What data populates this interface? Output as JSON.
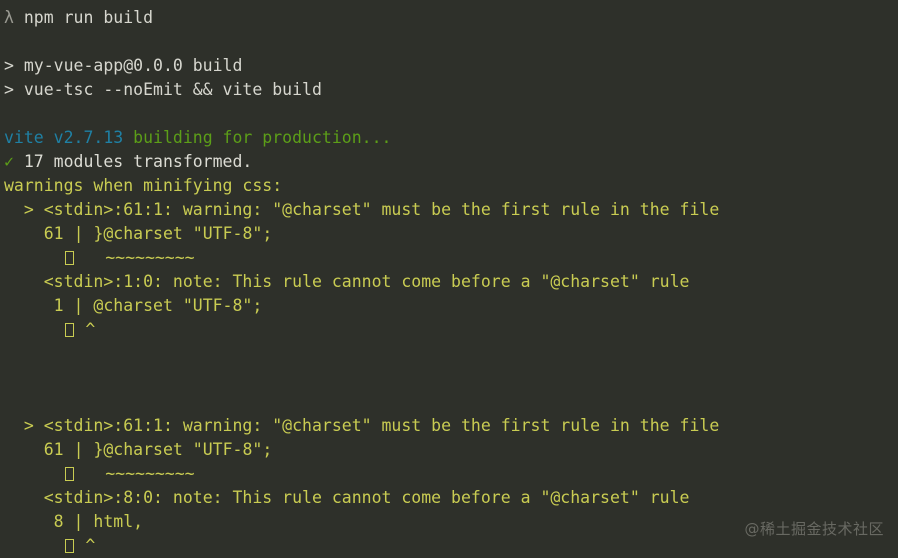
{
  "terminal": {
    "background_color": "#2e302a",
    "colors": {
      "plain": "#d6d6ce",
      "prompt": "#9a9a92",
      "cyan": "#1f80a4",
      "green": "#5c9e18",
      "yellow": "#c9cc52",
      "watermark": "#6c6d66"
    },
    "lines": {
      "prompt_symbol": "λ",
      "command": "npm run build",
      "npm_marker_1": ">",
      "npm_pkg": "my-vue-app@0.0.0 build",
      "npm_marker_2": ">",
      "npm_script": "vue-tsc --noEmit && vite build",
      "vite_name": "vite v2.7.13",
      "vite_action": "building for production...",
      "check_mark": "✓",
      "modules_transformed": "17 modules transformed.",
      "warnings_header": "warnings when minifying css:",
      "block1": {
        "bullet": ">",
        "warning_head": "<stdin>:61:1: warning: \"@charset\" must be the first rule in the file",
        "code_lineno": "61",
        "code_pipe": "|",
        "code_text": "}@charset \"UTF-8\";",
        "squiggle": "~~~~~~~~~",
        "note_head": "<stdin>:1:0: note: This rule cannot come before a \"@charset\" rule",
        "note_lineno": "1",
        "note_pipe": "|",
        "note_text": "@charset \"UTF-8\";",
        "caret": "^"
      },
      "block2": {
        "bullet": ">",
        "warning_head": "<stdin>:61:1: warning: \"@charset\" must be the first rule in the file",
        "code_lineno": "61",
        "code_pipe": "|",
        "code_text": "}@charset \"UTF-8\";",
        "squiggle": "~~~~~~~~~",
        "note_head": "<stdin>:8:0: note: This rule cannot come before a \"@charset\" rule",
        "note_lineno": "8",
        "note_pipe": "|",
        "note_text": "html,",
        "caret": "^"
      }
    },
    "watermark": "@稀土掘金技术社区"
  }
}
